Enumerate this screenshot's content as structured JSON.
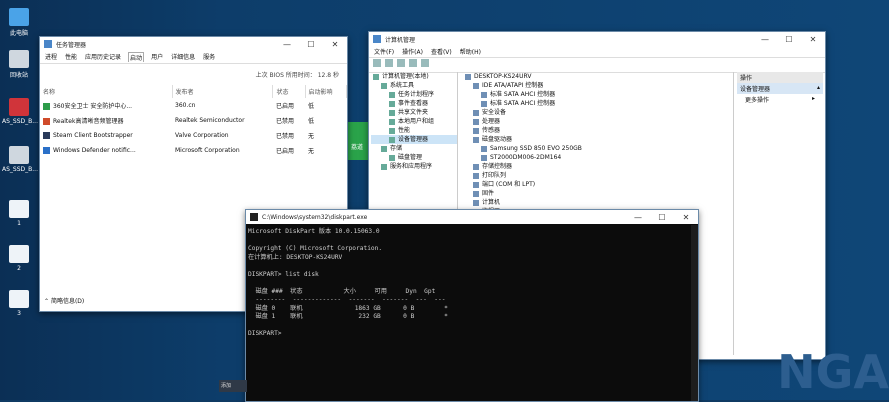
{
  "desktop": {
    "icons": [
      {
        "label": "此电脑",
        "color": "#4aa3e8"
      },
      {
        "label": "回收站",
        "color": "#cfd7df"
      },
      {
        "label": "AS_SSD_B...",
        "color": "#d0343a"
      },
      {
        "label": "AS_SSD_B...",
        "color": "#cfd7df"
      },
      {
        "label": "1",
        "color": "#eef3f8"
      },
      {
        "label": "2",
        "color": "#eef3f8"
      },
      {
        "label": "3",
        "color": "#eef3f8"
      }
    ],
    "badge_text": "荔道",
    "wallpaper_text": "NGA",
    "taskbar_search": "添加"
  },
  "task_manager": {
    "title": "任务管理器",
    "tabs": [
      "进程",
      "性能",
      "应用历史记录",
      "启动",
      "用户",
      "详细信息",
      "服务"
    ],
    "active_tab": 3,
    "bios_label": "上次 BIOS 所用时间：",
    "bios_value": "12.8 秒",
    "columns": [
      "名称",
      "发布者",
      "状态",
      "启动影响"
    ],
    "rows": [
      {
        "name": "360安全卫士 安全防护中心...",
        "publisher": "360.cn",
        "status": "已启用",
        "impact": "低",
        "color": "#2d9c4a"
      },
      {
        "name": "Realtek高清晰音频管理器",
        "publisher": "Realtek Semiconductor",
        "status": "已禁用",
        "impact": "低",
        "color": "#d04b2a"
      },
      {
        "name": "Steam Client Bootstrapper",
        "publisher": "Valve Corporation",
        "status": "已禁用",
        "impact": "无",
        "color": "#2a3a5a"
      },
      {
        "name": "Windows Defender notific...",
        "publisher": "Microsoft Corporation",
        "status": "已启用",
        "impact": "无",
        "color": "#2a70c8"
      }
    ],
    "fewer_details": "简略信息(D)"
  },
  "computer_management": {
    "title": "计算机管理",
    "menu": [
      "文件(F)",
      "操作(A)",
      "查看(V)",
      "帮助(H)"
    ],
    "tree": [
      {
        "label": "计算机管理(本地)",
        "indent": 0
      },
      {
        "label": "系统工具",
        "indent": 1
      },
      {
        "label": "任务计划程序",
        "indent": 2
      },
      {
        "label": "事件查看器",
        "indent": 2
      },
      {
        "label": "共享文件夹",
        "indent": 2
      },
      {
        "label": "本地用户和组",
        "indent": 2
      },
      {
        "label": "性能",
        "indent": 2
      },
      {
        "label": "设备管理器",
        "indent": 2,
        "selected": true
      },
      {
        "label": "存储",
        "indent": 1
      },
      {
        "label": "磁盘管理",
        "indent": 2
      },
      {
        "label": "服务和应用程序",
        "indent": 1
      }
    ],
    "devices": [
      {
        "label": "DESKTOP-KS24URV",
        "indent": 0
      },
      {
        "label": "IDE ATA/ATAPI 控制器",
        "indent": 1
      },
      {
        "label": "标准 SATA AHCI 控制器",
        "indent": 2
      },
      {
        "label": "标准 SATA AHCI 控制器",
        "indent": 2
      },
      {
        "label": "安全设备",
        "indent": 1
      },
      {
        "label": "处理器",
        "indent": 1
      },
      {
        "label": "传感器",
        "indent": 1
      },
      {
        "label": "磁盘驱动器",
        "indent": 1
      },
      {
        "label": "Samsung SSD 850 EVO 250GB",
        "indent": 2
      },
      {
        "label": "ST2000DM006-2DM164",
        "indent": 2
      },
      {
        "label": "存储控制器",
        "indent": 1
      },
      {
        "label": "打印队列",
        "indent": 1
      },
      {
        "label": "端口 (COM 和 LPT)",
        "indent": 1
      },
      {
        "label": "固件",
        "indent": 1
      },
      {
        "label": "计算机",
        "indent": 1
      },
      {
        "label": "监视器",
        "indent": 1
      },
      {
        "label": "键盘",
        "indent": 1
      }
    ],
    "actions_header": "操作",
    "actions_selected": "设备管理器",
    "actions_more": "更多操作"
  },
  "console": {
    "title": "C:\\Windows\\system32\\diskpart.exe",
    "lines": [
      "Microsoft DiskPart 版本 10.0.15063.0",
      "",
      "Copyright (C) Microsoft Corporation.",
      "在计算机上: DESKTOP-KS24URV",
      "",
      "DISKPART> list disk",
      "",
      "  磁盘 ###  状态           大小     可用     Dyn  Gpt",
      "  --------  -------------  -------  -------  ---  ---",
      "  磁盘 0    联机              1863 GB      0 B        *",
      "  磁盘 1    联机               232 GB      0 B        *",
      "",
      "DISKPART> "
    ]
  }
}
